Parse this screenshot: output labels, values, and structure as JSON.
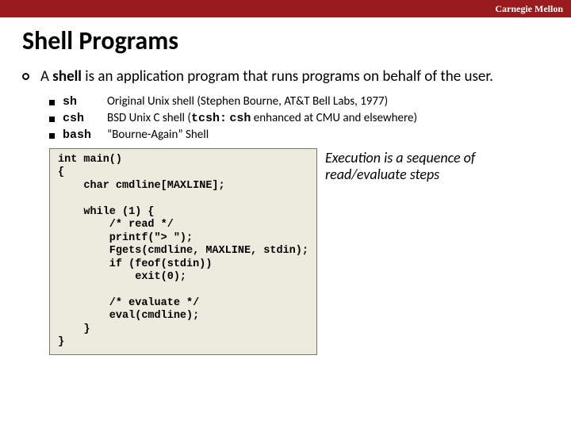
{
  "topbar": {
    "label": "Carnegie Mellon"
  },
  "title": "Shell Programs",
  "lead": {
    "pre": "A ",
    "bold1": "shell",
    "mid": " is an application program that runs programs on behalf of the user."
  },
  "shells": [
    {
      "name": "sh",
      "desc_pre": "Original Unix shell (Stephen Bourne, AT&T Bell Labs, 1977)",
      "desc_code1": "",
      "desc_mid": "",
      "desc_code2": "",
      "desc_post": ""
    },
    {
      "name": "csh",
      "desc_pre": "BSD Unix C shell (",
      "desc_code1": "tcsh:",
      "desc_mid": " ",
      "desc_code2": "csh",
      "desc_post": " enhanced at CMU and elsewhere)"
    },
    {
      "name": "bash",
      "desc_pre": "“Bourne-Again” Shell",
      "desc_code1": "",
      "desc_mid": "",
      "desc_code2": "",
      "desc_post": ""
    }
  ],
  "code": "int main()\n{\n    char cmdline[MAXLINE];\n\n    while (1) {\n        /* read */\n        printf(\"> \");\n        Fgets(cmdline, MAXLINE, stdin);\n        if (feof(stdin))\n            exit(0);\n\n        /* evaluate */\n        eval(cmdline);\n    }\n}",
  "note": "Execution is a sequence of read/evaluate steps"
}
